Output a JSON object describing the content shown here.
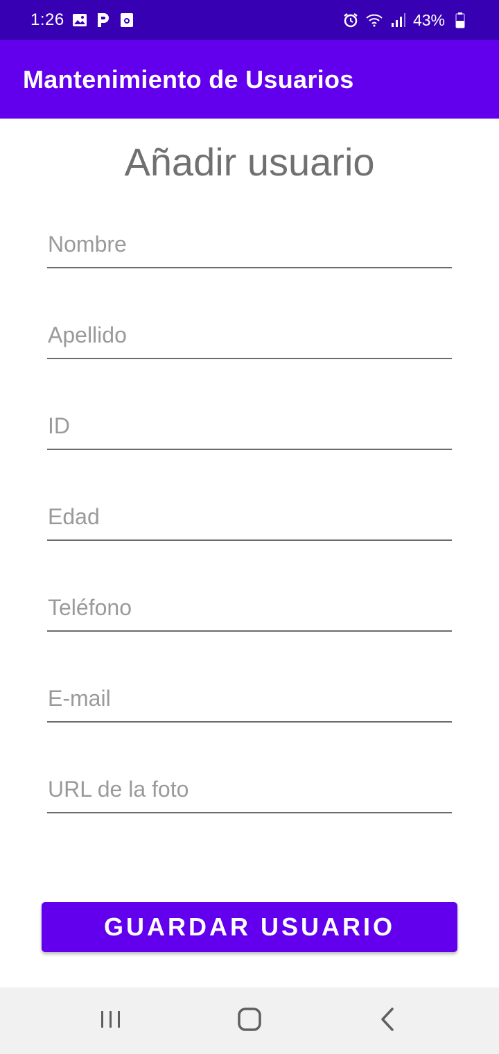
{
  "status_bar": {
    "time": "1:26",
    "battery": "43%",
    "left_icons": [
      "gallery-icon",
      "parking-icon",
      "screen-record-icon"
    ],
    "right_icons": [
      "alarm-icon",
      "wifi-icon",
      "signal-icon",
      "battery-icon"
    ]
  },
  "app_bar": {
    "title": "Mantenimiento de Usuarios",
    "color": "#6200ee",
    "status_color": "#3700b3"
  },
  "form": {
    "heading": "Añadir usuario",
    "fields": [
      {
        "name": "nombre",
        "placeholder": "Nombre",
        "value": ""
      },
      {
        "name": "apellido",
        "placeholder": "Apellido",
        "value": ""
      },
      {
        "name": "id",
        "placeholder": "ID",
        "value": ""
      },
      {
        "name": "edad",
        "placeholder": "Edad",
        "value": ""
      },
      {
        "name": "telefono",
        "placeholder": "Teléfono",
        "value": ""
      },
      {
        "name": "email",
        "placeholder": "E-mail",
        "value": ""
      },
      {
        "name": "url-foto",
        "placeholder": "URL de la foto",
        "value": ""
      }
    ],
    "save_label": "GUARDAR USUARIO"
  },
  "nav_bar": {
    "buttons": [
      "recent-apps-icon",
      "home-icon",
      "back-icon"
    ]
  }
}
